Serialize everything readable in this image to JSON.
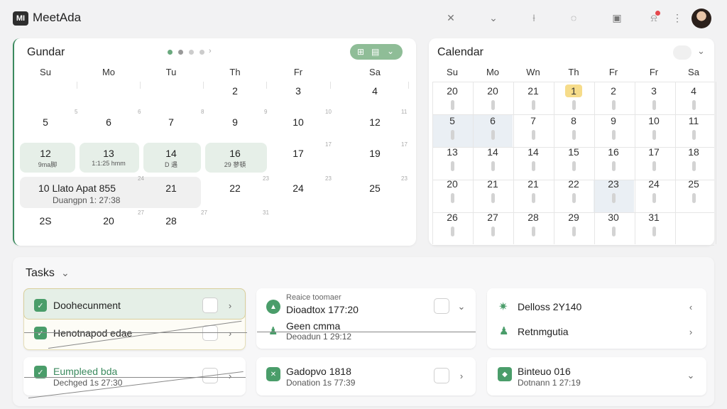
{
  "app": {
    "title": "MeetAda",
    "logo_text": "MI"
  },
  "toolbar_icons": [
    "close-small-icon",
    "chevron-down-icon",
    "pin-icon",
    "chat-icon",
    "calendar-icon",
    "bell-icon",
    "more-vert-icon"
  ],
  "left_calendar": {
    "title": "Gundar",
    "days_of_week": [
      "Su",
      "Mo",
      "Tu",
      "Th",
      "Fr",
      "Sa"
    ],
    "row1": [
      "2",
      "3",
      "4"
    ],
    "row2": [
      "5",
      "6",
      "7",
      "9",
      "10",
      "12"
    ],
    "row2_mini": [
      "5",
      "6",
      "8",
      "9",
      "10",
      "11"
    ],
    "row3": [
      "12",
      "13",
      "14",
      "16",
      "17",
      "19"
    ],
    "row3_sub": [
      "9ma脚",
      "1:1:25 hmm",
      "D 遇",
      "29 蓼頓"
    ],
    "row3_mini": [
      "17",
      "17"
    ],
    "row4": [
      "21",
      "22",
      "24",
      "25"
    ],
    "row4_mini": [
      "24",
      "23",
      "23",
      "23"
    ],
    "event_title": "10 Llato Apat 855",
    "event_time": "Duangpn 1: 27:38",
    "row5": [
      "2S",
      "20",
      "28"
    ],
    "row5_mini": [
      "27",
      "27",
      "31"
    ]
  },
  "right_calendar": {
    "title": "Calendar",
    "days_of_week": [
      "Su",
      "Mo",
      "Wn",
      "Th",
      "Fr",
      "Fr",
      "Sa"
    ],
    "weeks": [
      [
        "20",
        "20",
        "21",
        "1",
        "2",
        "3",
        "4"
      ],
      [
        "5",
        "6",
        "7",
        "8",
        "9",
        "10",
        "11"
      ],
      [
        "13",
        "14",
        "14",
        "15",
        "16",
        "17",
        "18"
      ],
      [
        "20",
        "21",
        "21",
        "22",
        "23",
        "24",
        "25"
      ],
      [
        "26",
        "27",
        "28",
        "29",
        "30",
        "31",
        ""
      ]
    ],
    "highlight_color": "#f6dc8a"
  },
  "tasks": {
    "title": "Tasks",
    "col1": [
      {
        "title": "Doohecunment"
      },
      {
        "title": "Henotnapod edae"
      },
      {
        "title": "Eumpleed bda",
        "time": "Dechged 1s 27:30"
      }
    ],
    "col2": [
      {
        "header": "Reaice toomaer",
        "title": "Dioadtox 177:20"
      },
      {
        "title": "Geen cmma",
        "time": "Deoadun 1 29:12"
      },
      {
        "title": "Gadopvo 1818",
        "time": "Donation 1s 77:39"
      }
    ],
    "col3": [
      {
        "title": "Delloss 2Y140"
      },
      {
        "title": "Retnmgutia"
      },
      {
        "title": "Binteuo 016",
        "time": "Dotnann 1 27:19"
      }
    ]
  },
  "colors": {
    "accent": "#4a9d6a",
    "pill": "#8fbd97",
    "notify": "#e5484d"
  }
}
